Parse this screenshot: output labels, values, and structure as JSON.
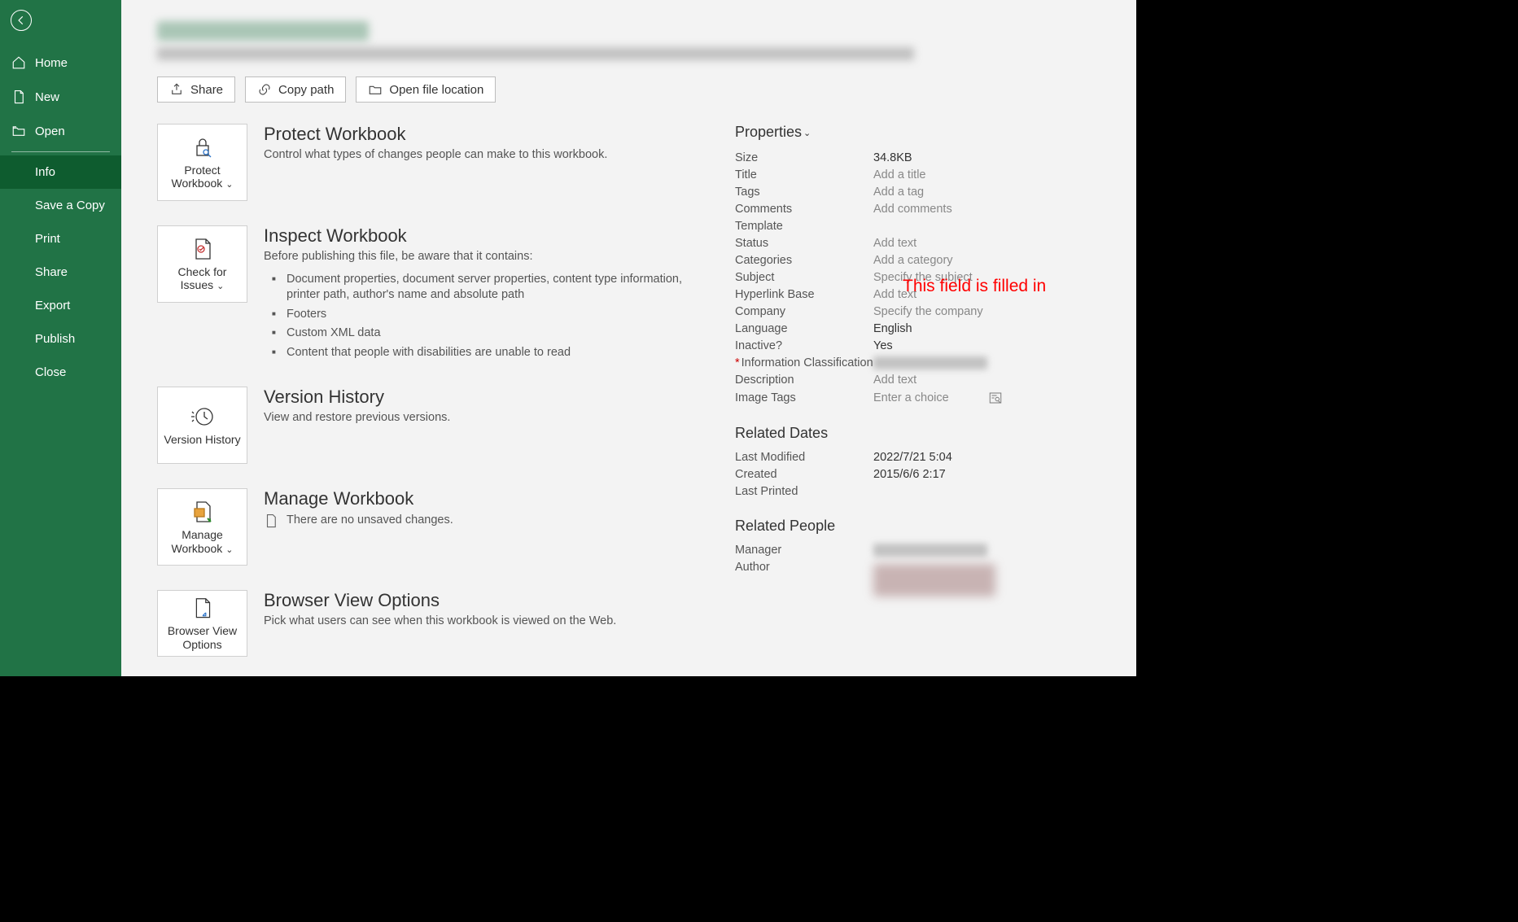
{
  "sidebar": {
    "home": "Home",
    "new": "New",
    "open": "Open",
    "info": "Info",
    "save_copy": "Save a Copy",
    "print": "Print",
    "share": "Share",
    "export": "Export",
    "publish": "Publish",
    "close": "Close"
  },
  "actions": {
    "share": "Share",
    "copy_path": "Copy path",
    "open_location": "Open file location"
  },
  "sections": {
    "protect": {
      "tile": "Protect Workbook",
      "title": "Protect Workbook",
      "desc": "Control what types of changes people can make to this workbook."
    },
    "inspect": {
      "tile": "Check for Issues",
      "title": "Inspect Workbook",
      "desc": "Before publishing this file, be aware that it contains:",
      "items": [
        "Document properties, document server properties, content type information, printer path, author's name and absolute path",
        "Footers",
        "Custom XML data",
        "Content that people with disabilities are unable to read"
      ]
    },
    "version": {
      "tile": "Version History",
      "title": "Version History",
      "desc": "View and restore previous versions."
    },
    "manage": {
      "tile": "Manage Workbook",
      "title": "Manage Workbook",
      "desc": "There are no unsaved changes."
    },
    "browser": {
      "tile": "Browser View Options",
      "title": "Browser View Options",
      "desc": "Pick what users can see when this workbook is viewed on the Web."
    }
  },
  "properties": {
    "header": "Properties",
    "size_label": "Size",
    "size_value": "34.8KB",
    "title_label": "Title",
    "title_placeholder": "Add a title",
    "tags_label": "Tags",
    "tags_placeholder": "Add a tag",
    "comments_label": "Comments",
    "comments_placeholder": "Add comments",
    "template_label": "Template",
    "status_label": "Status",
    "status_placeholder": "Add text",
    "categories_label": "Categories",
    "categories_placeholder": "Add a category",
    "subject_label": "Subject",
    "subject_placeholder": "Specify the subject",
    "hyperlink_label": "Hyperlink Base",
    "hyperlink_placeholder": "Add text",
    "company_label": "Company",
    "company_placeholder": "Specify the company",
    "language_label": "Language",
    "language_value": "English",
    "inactive_label": "Inactive?",
    "inactive_value": "Yes",
    "infoclass_label": "Information Classification",
    "description_label": "Description",
    "description_placeholder": "Add text",
    "imagetags_label": "Image Tags",
    "imagetags_placeholder": "Enter a choice"
  },
  "related_dates": {
    "header": "Related Dates",
    "modified_label": "Last Modified",
    "modified_value": "2022/7/21 5:04",
    "created_label": "Created",
    "created_value": "2015/6/6 2:17",
    "printed_label": "Last Printed"
  },
  "related_people": {
    "header": "Related People",
    "manager_label": "Manager",
    "author_label": "Author"
  },
  "annotation": "This field is filled in"
}
